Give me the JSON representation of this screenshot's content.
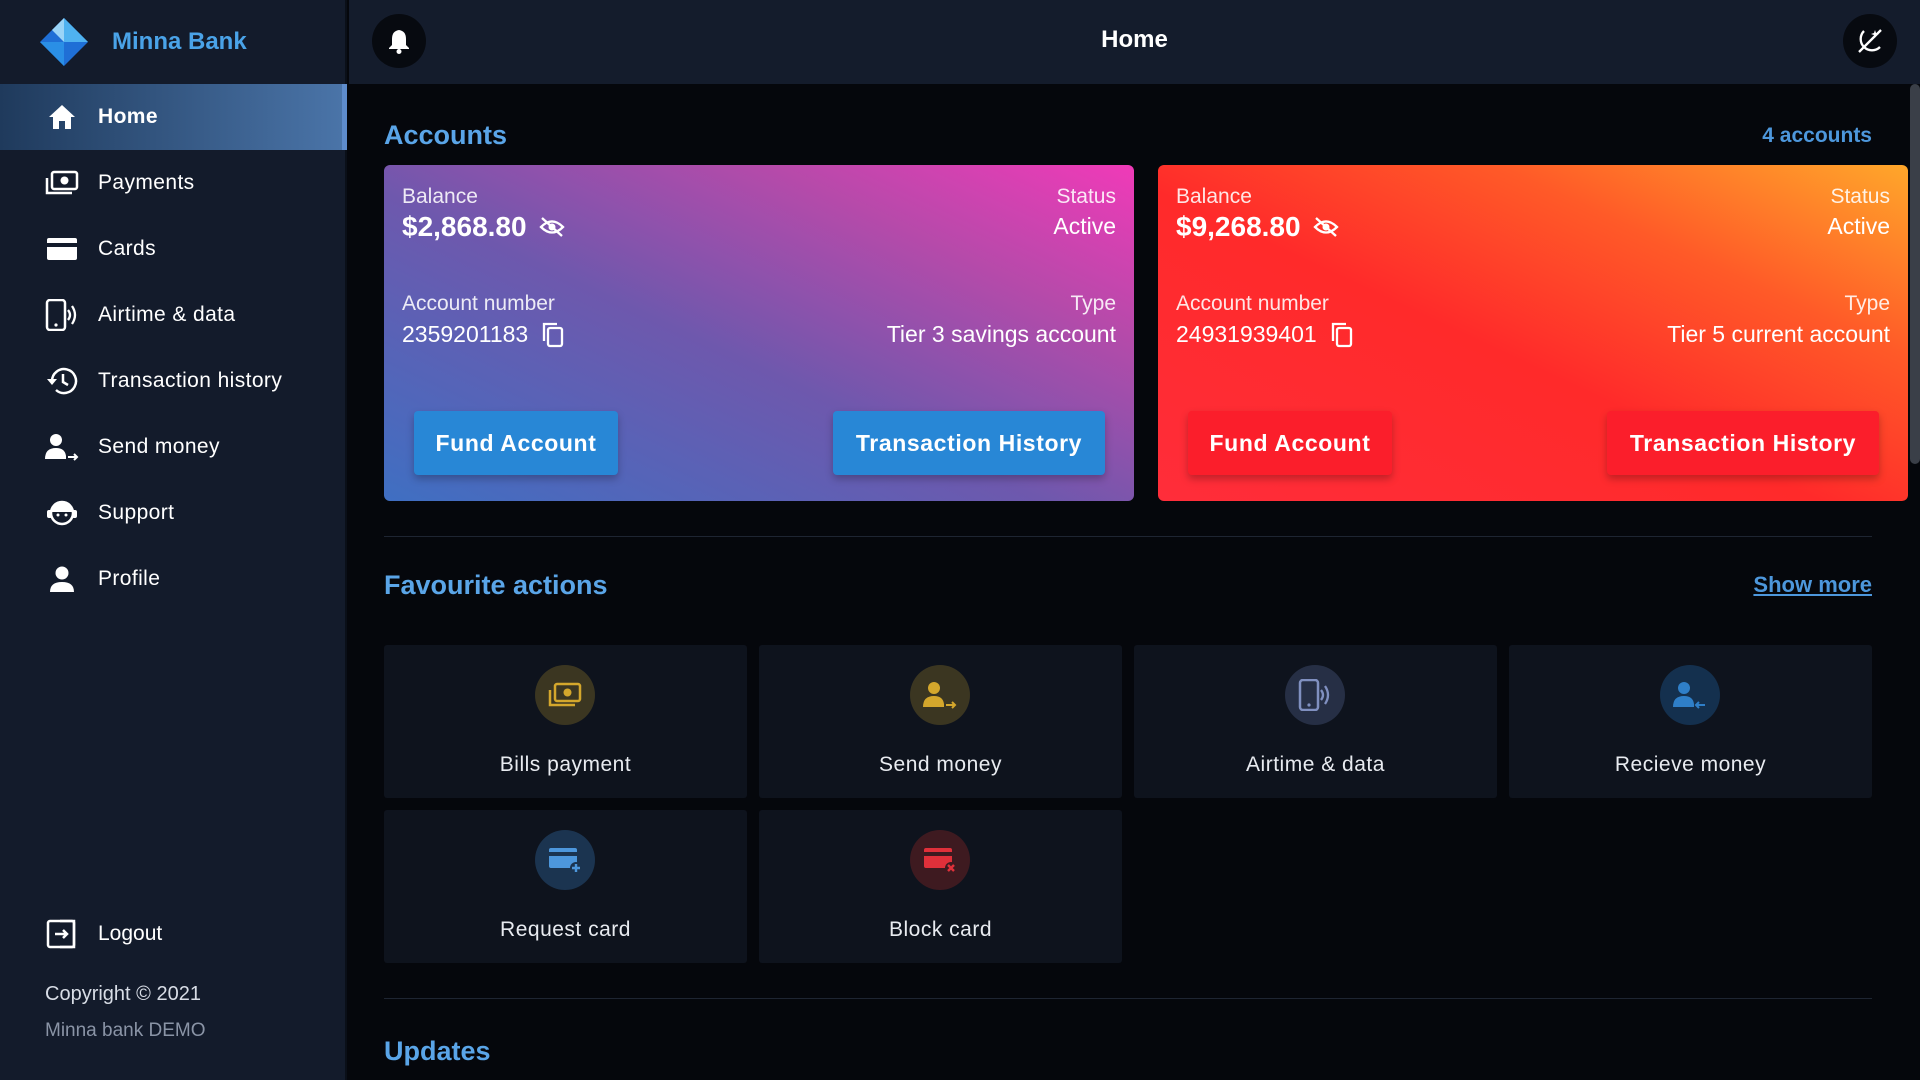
{
  "app": {
    "name": "Minna Bank"
  },
  "topbar": {
    "title": "Home"
  },
  "sidebar": {
    "items": [
      {
        "label": "Home",
        "icon": "home-icon",
        "active": true
      },
      {
        "label": "Payments",
        "icon": "payments-icon"
      },
      {
        "label": "Cards",
        "icon": "card-icon"
      },
      {
        "label": "Airtime & data",
        "icon": "phone-signal-icon"
      },
      {
        "label": "Transaction history",
        "icon": "history-icon"
      },
      {
        "label": "Send money",
        "icon": "send-money-icon"
      },
      {
        "label": "Support",
        "icon": "support-icon"
      },
      {
        "label": "Profile",
        "icon": "profile-icon"
      }
    ],
    "logout": "Logout",
    "copyright": "Copyright © 2021",
    "demo": "Minna bank DEMO"
  },
  "accounts": {
    "title": "Accounts",
    "count": "4 accounts",
    "cards": [
      {
        "balance_label": "Balance",
        "balance": "$2,868.80",
        "status_label": "Status",
        "status": "Active",
        "number_label": "Account number",
        "number": "2359201183",
        "type_label": "Type",
        "type": "Tier 3 savings account",
        "fund_button": "Fund Account",
        "history_button": "Transaction History",
        "button_color": "#2887d6"
      },
      {
        "balance_label": "Balance",
        "balance": "$9,268.80",
        "status_label": "Status",
        "status": "Active",
        "number_label": "Account number",
        "number": "24931939401",
        "type_label": "Type",
        "type": "Tier 5 current account",
        "fund_button": "Fund Account",
        "history_button": "Transaction History",
        "button_color": "#fb1e2b"
      }
    ]
  },
  "favourites": {
    "title": "Favourite actions",
    "show_more": "Show more",
    "items": [
      {
        "label": "Bills payment",
        "icon": "bills-icon",
        "color": "#d4a72c"
      },
      {
        "label": "Send money",
        "icon": "send-money-icon",
        "color": "#d4a72c"
      },
      {
        "label": "Airtime & data",
        "icon": "phone-signal-icon",
        "color": "#8090c0"
      },
      {
        "label": "Recieve money",
        "icon": "receive-money-icon",
        "color": "#2f7fc8"
      },
      {
        "label": "Request card",
        "icon": "add-card-icon",
        "color": "#4d97dc"
      },
      {
        "label": "Block card",
        "icon": "block-card-icon",
        "color": "#e0303a"
      }
    ]
  },
  "updates": {
    "title": "Updates"
  }
}
